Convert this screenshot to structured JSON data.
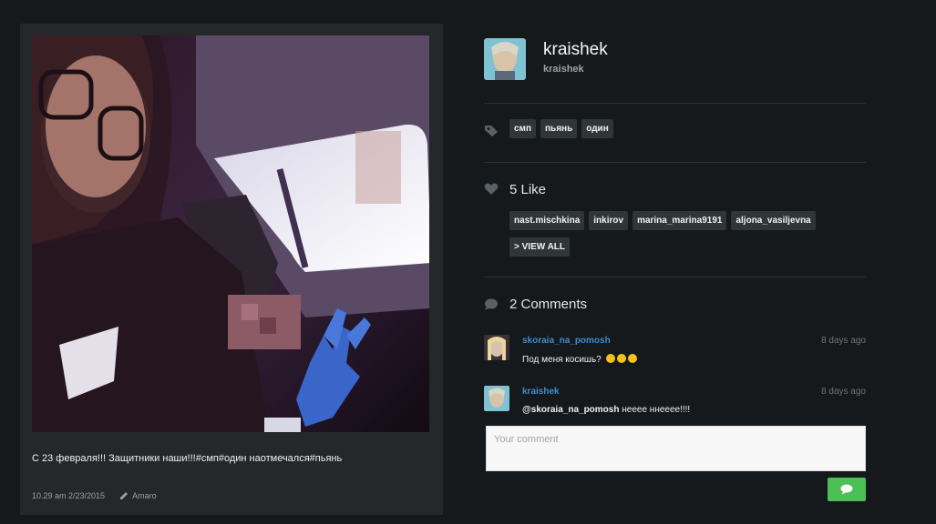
{
  "post": {
    "caption": "С 23 февраля!!! Защитники наши!!!#смп#один наотмечался#пьянь",
    "timestamp": "10.29 am 2/23/2015",
    "filter": "Amaro"
  },
  "profile": {
    "display_name": "kraishek",
    "username": "kraishek"
  },
  "tags": [
    "смп",
    "пьянь",
    "один"
  ],
  "likes": {
    "title": "5 Like",
    "users": [
      "nast.mischkina",
      "inkirov",
      "marina_marina9191",
      "aljona_vasiljevna"
    ],
    "view_all": "> VIEW ALL"
  },
  "comments": {
    "title": "2 Comments",
    "items": [
      {
        "user": "skoraia_na_pomosh",
        "time": "8 days ago",
        "text": "Под меня косишь?",
        "emoji_count": 3
      },
      {
        "user": "kraishek",
        "time": "8 days ago",
        "mention": "@skoraia_na_pomosh",
        "text": " неeee ннeeee!!!!"
      }
    ],
    "placeholder": "Your comment"
  },
  "colors": {
    "background": "#16191b",
    "card": "#24282a",
    "pill": "#303538",
    "link": "#3b8dd1",
    "send": "#4cbf57"
  },
  "icons": [
    "tag-icon",
    "heart-icon",
    "speech-bubble-icon",
    "pencil-icon",
    "send-icon"
  ]
}
